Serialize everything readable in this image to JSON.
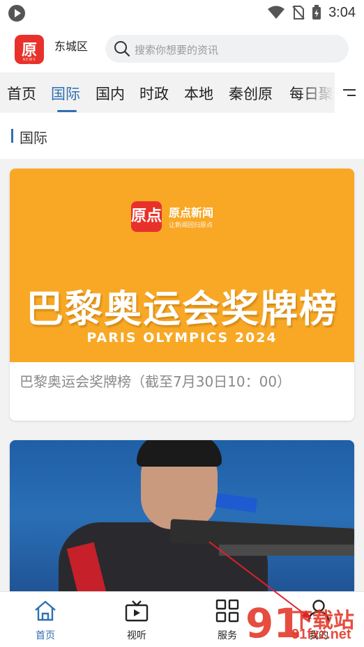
{
  "status_bar": {
    "time": "3:04"
  },
  "header": {
    "logo_text": "原点",
    "logo_sub": "NEWS",
    "location": "东城区",
    "search_placeholder": "搜索你想要的资讯"
  },
  "tabs": {
    "items": [
      "首页",
      "国际",
      "国内",
      "时政",
      "本地",
      "秦创原",
      "每日聚"
    ],
    "active_index": 1
  },
  "section": {
    "title": "国际"
  },
  "cards": [
    {
      "banner_brand": "原点新闻",
      "banner_slogan": "让新闻回归原点",
      "banner_title": "巴黎奥运会奖牌榜",
      "banner_subtitle": "PARIS OLYMPICS 2024",
      "caption": "巴黎奥运会奖牌榜（截至7月30日10：00）"
    }
  ],
  "bottom_nav": {
    "items": [
      {
        "label": "首页",
        "icon": "home-icon",
        "active": true
      },
      {
        "label": "视听",
        "icon": "tv-icon",
        "active": false
      },
      {
        "label": "服务",
        "icon": "grid-icon",
        "active": false
      },
      {
        "label": "我的",
        "icon": "user-icon",
        "active": false
      }
    ]
  },
  "watermark": {
    "big": "91",
    "top": "下载站",
    "bottom": "91fxz.net"
  },
  "colors": {
    "accent": "#2f6fb1",
    "brand_red": "#e8312a",
    "banner_orange": "#f8a825"
  }
}
